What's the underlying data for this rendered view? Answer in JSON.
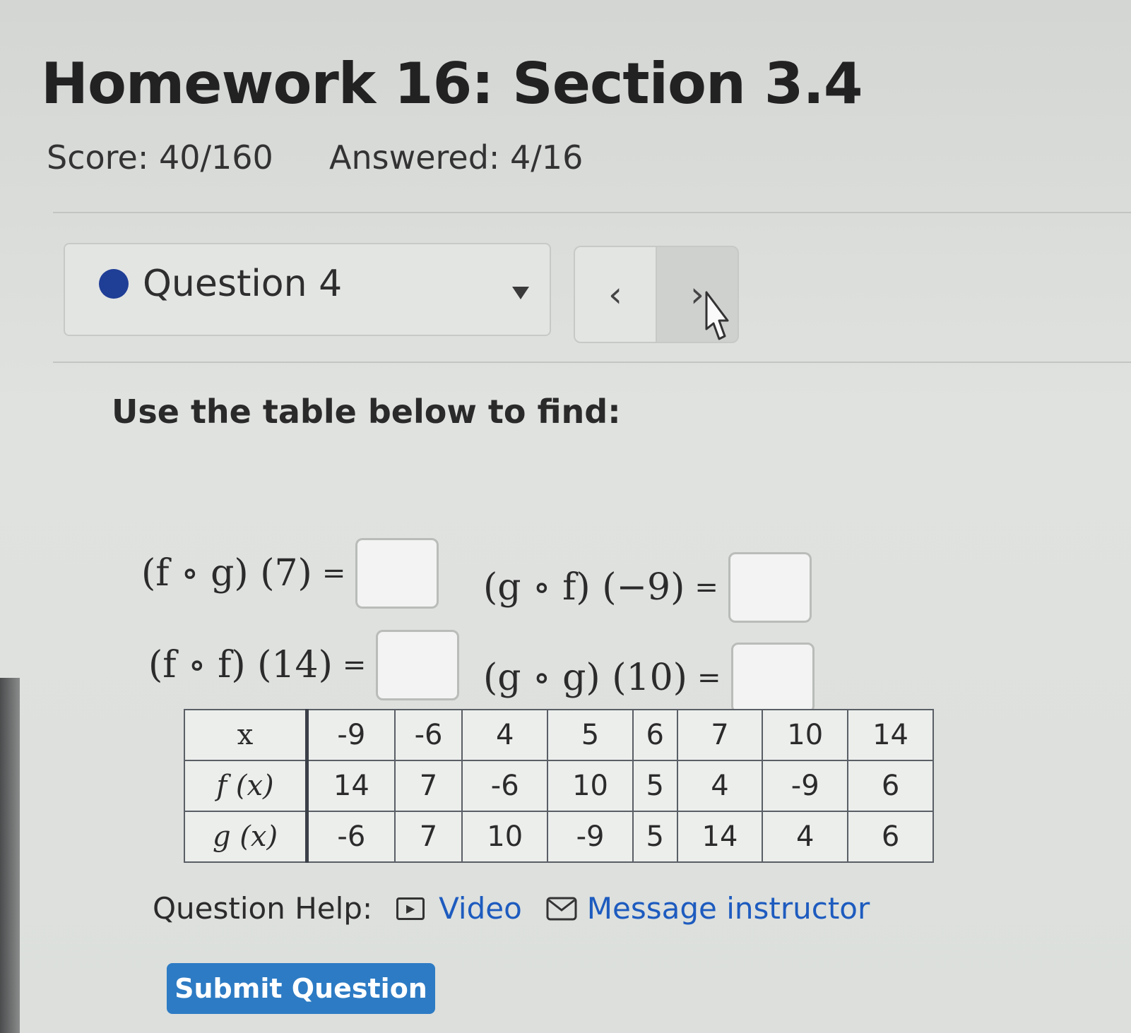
{
  "page": {
    "title": "Homework 16: Section 3.4"
  },
  "status": {
    "score": "Score: 40/160",
    "answered": "Answered: 4/16"
  },
  "question_selector": {
    "label": "Question 4",
    "prev": "‹",
    "next": "›"
  },
  "question": {
    "instruction": "Use the table below to find:",
    "expressions": [
      {
        "left": "(f ∘ g) (7)",
        "eq": "="
      },
      {
        "left": "(g ∘ f) (−9)",
        "eq": "="
      },
      {
        "left": "(f ∘ f) (14)",
        "eq": "="
      },
      {
        "left": "(g ∘ g) (10)",
        "eq": "="
      }
    ]
  },
  "table": {
    "headers": [
      "x",
      "f (x)",
      "g (x)"
    ],
    "x": [
      "-9",
      "-6",
      "4",
      "5",
      "6",
      "7",
      "10",
      "14"
    ],
    "f": [
      "14",
      "7",
      "-6",
      "10",
      "5",
      "4",
      "-9",
      "6"
    ],
    "g": [
      "-6",
      "7",
      "10",
      "-9",
      "5",
      "14",
      "4",
      "6"
    ]
  },
  "help": {
    "label": "Question Help:",
    "video": "Video",
    "message": "Message instructor"
  },
  "submit": {
    "label": "Submit Question"
  },
  "colors": {
    "accent": "#2d7bc4",
    "link": "#1d5bbf",
    "dot": "#1f3e96"
  }
}
